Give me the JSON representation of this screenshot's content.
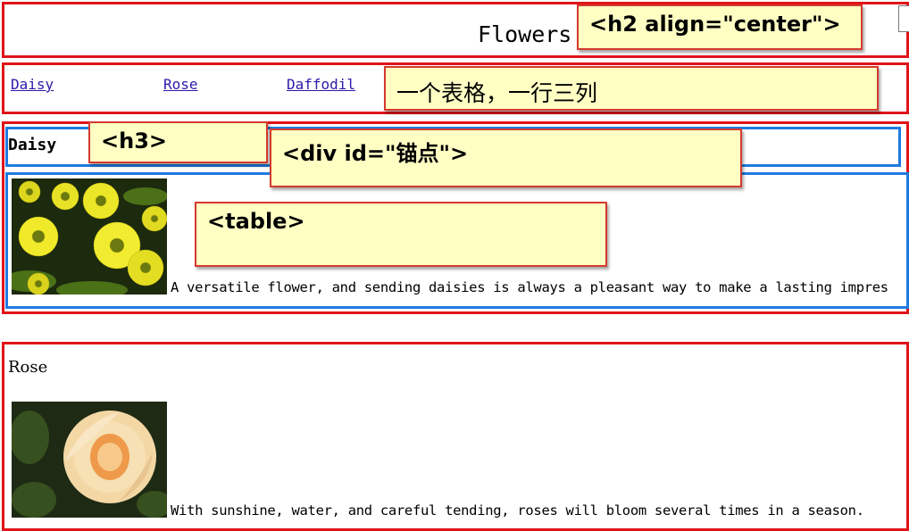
{
  "page": {
    "title": "Flowers"
  },
  "nav": {
    "links": [
      "Daisy",
      "Rose",
      "Daffodil"
    ]
  },
  "annotations": {
    "h2": "<h2 align=\"center\">",
    "table_row": "一个表格，一行三列",
    "h3": "<h3>",
    "div_anchor": "<div id=\"锚点\">",
    "table": "<table>"
  },
  "sections": [
    {
      "heading": "Daisy",
      "caption": "A versatile flower, and sending daisies is always a pleasant way to make a lasting impres"
    },
    {
      "heading": "Rose",
      "caption": "With sunshine, water, and careful tending, roses will bloom several times in a season."
    }
  ],
  "colors": {
    "annotation_border": "#e0141a",
    "annotation_blue": "#1f7ae0",
    "note_bg": "#ffffc4",
    "link": "#2a1aa8"
  }
}
